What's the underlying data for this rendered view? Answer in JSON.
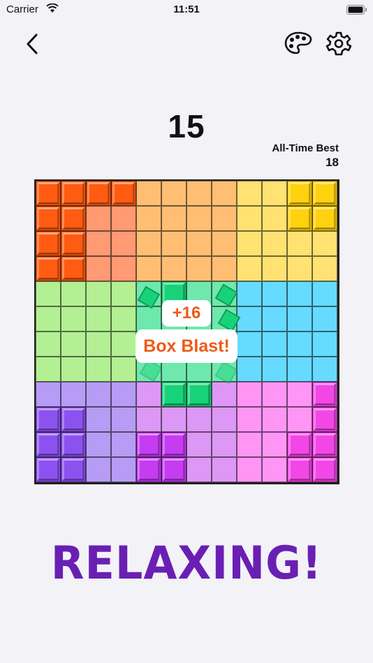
{
  "status_bar": {
    "carrier": "Carrier",
    "time": "11:51"
  },
  "nav": {
    "back_icon": "chevron-left-icon",
    "palette_icon": "palette-icon",
    "settings_icon": "gear-icon"
  },
  "score": {
    "current": "15",
    "best_label": "All-Time Best",
    "best_value": "18"
  },
  "board": {
    "size": 12,
    "quadrant_colors": [
      [
        "#ff9a72",
        "#ffbe73",
        "#ffe272"
      ],
      [
        "#b3ef93",
        "#6ee8ac",
        "#66daff"
      ],
      [
        "#b69cf5",
        "#dc98f4",
        "#ff96f6"
      ]
    ],
    "blocks": [
      {
        "color": "#ff5b12",
        "cells": [
          [
            0,
            0
          ],
          [
            0,
            1
          ],
          [
            0,
            2
          ],
          [
            0,
            3
          ],
          [
            1,
            0
          ],
          [
            1,
            1
          ],
          [
            2,
            0
          ],
          [
            2,
            1
          ],
          [
            3,
            0
          ],
          [
            3,
            1
          ]
        ]
      },
      {
        "color": "#ffd10f",
        "cells": [
          [
            0,
            10
          ],
          [
            0,
            11
          ],
          [
            1,
            10
          ],
          [
            1,
            11
          ]
        ]
      },
      {
        "color": "#18d27a",
        "cells": [
          [
            4,
            5
          ],
          [
            8,
            5
          ],
          [
            8,
            6
          ]
        ]
      },
      {
        "color": "#8c52f0",
        "cells": [
          [
            9,
            0
          ],
          [
            9,
            1
          ],
          [
            10,
            0
          ],
          [
            10,
            1
          ],
          [
            11,
            0
          ],
          [
            11,
            1
          ]
        ]
      },
      {
        "color": "#c53cf2",
        "cells": [
          [
            10,
            4
          ],
          [
            10,
            5
          ],
          [
            11,
            4
          ],
          [
            11,
            5
          ]
        ]
      },
      {
        "color": "#f247e6",
        "cells": [
          [
            8,
            11
          ],
          [
            9,
            11
          ],
          [
            10,
            10
          ],
          [
            10,
            11
          ],
          [
            11,
            10
          ],
          [
            11,
            11
          ]
        ]
      }
    ],
    "shards_color": "#18d27a"
  },
  "popups": {
    "combo": "+16",
    "blast": "Box Blast!"
  },
  "tagline": "RELAXING!"
}
